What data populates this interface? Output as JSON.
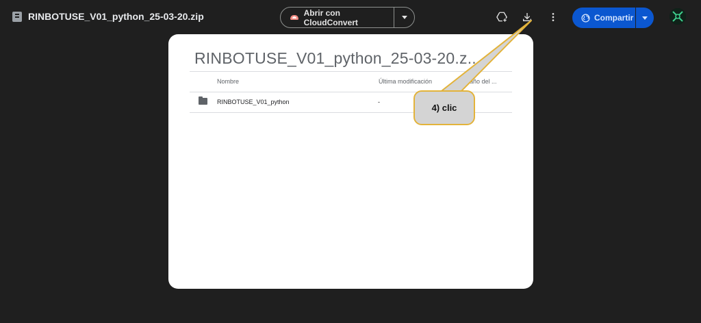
{
  "header": {
    "file_title": "RINBOTUSE_V01_python_25-03-20.zip",
    "open_with_label": "Abrir con CloudConvert",
    "share_label": "Compartir"
  },
  "preview": {
    "title": "RINBOTUSE_V01_python_25-03-20.z...",
    "columns": [
      "Nombre",
      "Última modificación",
      "Tamaño del ..."
    ],
    "rows": [
      {
        "name": "RINBOTUSE_V01_python",
        "modified": "-",
        "size": ""
      }
    ]
  },
  "callout": {
    "text": "4) clic"
  },
  "colors": {
    "background": "#1f1f1f",
    "share_button": "#0b57d0",
    "callout_fill": "#d4d4d4",
    "callout_border": "#e3b33a"
  },
  "icons": [
    "file-icon",
    "cloud-icon",
    "add-to-drive-icon",
    "download-icon",
    "more-vert-icon",
    "globe-icon",
    "folder-icon"
  ]
}
